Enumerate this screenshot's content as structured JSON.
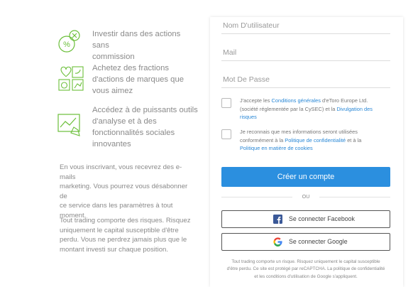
{
  "features": [
    {
      "icon": "percent-no-commission-icon",
      "lines": [
        "Investir dans des actions sans",
        "commission"
      ]
    },
    {
      "icon": "brand-social-icons-icon",
      "lines": [
        "Achetez des fractions",
        "d'actions de marques que",
        "vous aimez"
      ]
    },
    {
      "icon": "analysis-chart-icon",
      "lines": [
        "Accédez à de puissants outils",
        "d'analyse et à des",
        "fonctionnalités sociales",
        "innovantes"
      ]
    }
  ],
  "paragraphs": {
    "marketing": [
      "En vous inscrivant, vous recevrez des e-mails",
      "marketing. Vous pourrez vous désabonner de",
      "ce service dans les paramètres à tout",
      "moment."
    ],
    "risk": [
      "Tout trading comporte des risques. Risquez",
      "uniquement le capital susceptible d'être",
      "perdu. Vous ne perdrez jamais plus que le",
      "montant investi sur chaque position."
    ]
  },
  "form": {
    "username_placeholder": "Nom D'utilisateur",
    "email_placeholder": "Mail",
    "password_placeholder": "Mot De Passe",
    "terms": {
      "l1_a": "J'accepte les ",
      "l1_link": "Conditions générales",
      "l1_b": " d'eToro Europe Ltd.",
      "l2_a": "(société réglementée par la CySEC) et la ",
      "l2_link": "Divulgation des",
      "l3_link": "risques"
    },
    "privacy": {
      "l1": "Je reconnais que mes informations seront utilisées",
      "l2_a": "conformément à la ",
      "l2_link": "Politique de confidentialité",
      "l2_b": " et à la",
      "l3_link": "Politique en matière de cookies"
    },
    "create_button": "Créer un compte",
    "or_label": "OU",
    "facebook_button": "Se connecter Facebook",
    "google_button": "Se connecter Google",
    "footer_lines": [
      "Tout trading comporte un risque. Risquez uniquement le capital susceptible",
      "d'être perdu. Ce site est protégé par reCAPTCHA. La politique de confidentialité",
      "et les conditions d'utilisation de Google s'appliquent."
    ]
  },
  "colors": {
    "accent_green": "#6bbf3a",
    "primary_blue": "#2b8fdf",
    "link_blue": "#2a88d6",
    "facebook_blue": "#3b5998"
  }
}
